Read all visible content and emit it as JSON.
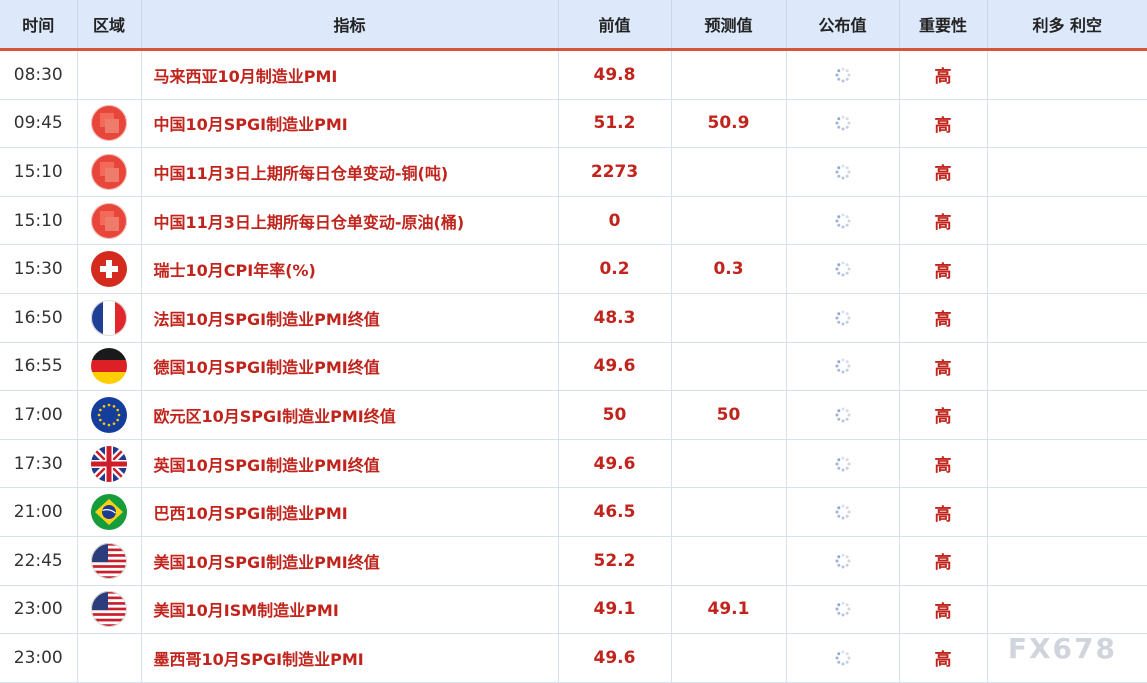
{
  "header": {
    "time": "时间",
    "region": "区域",
    "indicator": "指标",
    "previous": "前值",
    "forecast": "预测值",
    "actual": "公布值",
    "importance": "重要性",
    "effect": "利多 利空"
  },
  "colors": {
    "accent_red": "#c0241c",
    "header_bg": "#dde9fb",
    "header_border": "#d4553c"
  },
  "rows": [
    {
      "time": "08:30",
      "flag": "none",
      "indicator": "马来西亚10月制造业PMI",
      "previous": "49.8",
      "forecast": "",
      "actual": "",
      "importance": "高",
      "effect": ""
    },
    {
      "time": "09:45",
      "flag": "china-flag-blurred",
      "indicator": "中国10月SPGI制造业PMI",
      "previous": "51.2",
      "forecast": "50.9",
      "actual": "",
      "importance": "高",
      "effect": ""
    },
    {
      "time": "15:10",
      "flag": "china-flag-blurred",
      "indicator": "中国11月3日上期所每日仓单变动-铜(吨)",
      "previous": "2273",
      "forecast": "",
      "actual": "",
      "importance": "高",
      "effect": ""
    },
    {
      "time": "15:10",
      "flag": "china-flag-blurred",
      "indicator": "中国11月3日上期所每日仓单变动-原油(桶)",
      "previous": "0",
      "forecast": "",
      "actual": "",
      "importance": "高",
      "effect": ""
    },
    {
      "time": "15:30",
      "flag": "switzerland-flag",
      "indicator": "瑞士10月CPI年率(%)",
      "previous": "0.2",
      "forecast": "0.3",
      "actual": "",
      "importance": "高",
      "effect": ""
    },
    {
      "time": "16:50",
      "flag": "france-flag",
      "indicator": "法国10月SPGI制造业PMI终值",
      "previous": "48.3",
      "forecast": "",
      "actual": "",
      "importance": "高",
      "effect": ""
    },
    {
      "time": "16:55",
      "flag": "germany-flag",
      "indicator": "德国10月SPGI制造业PMI终值",
      "previous": "49.6",
      "forecast": "",
      "actual": "",
      "importance": "高",
      "effect": ""
    },
    {
      "time": "17:00",
      "flag": "eu-flag",
      "indicator": "欧元区10月SPGI制造业PMI终值",
      "previous": "50",
      "forecast": "50",
      "actual": "",
      "importance": "高",
      "effect": ""
    },
    {
      "time": "17:30",
      "flag": "uk-flag",
      "indicator": "英国10月SPGI制造业PMI终值",
      "previous": "49.6",
      "forecast": "",
      "actual": "",
      "importance": "高",
      "effect": ""
    },
    {
      "time": "21:00",
      "flag": "brazil-flag",
      "indicator": "巴西10月SPGI制造业PMI",
      "previous": "46.5",
      "forecast": "",
      "actual": "",
      "importance": "高",
      "effect": ""
    },
    {
      "time": "22:45",
      "flag": "usa-flag",
      "indicator": "美国10月SPGI制造业PMI终值",
      "previous": "52.2",
      "forecast": "",
      "actual": "",
      "importance": "高",
      "effect": ""
    },
    {
      "time": "23:00",
      "flag": "usa-flag",
      "indicator": "美国10月ISM制造业PMI",
      "previous": "49.1",
      "forecast": "49.1",
      "actual": "",
      "importance": "高",
      "effect": ""
    },
    {
      "time": "23:00",
      "flag": "none",
      "indicator": "墨西哥10月SPGI制造业PMI",
      "previous": "49.6",
      "forecast": "",
      "actual": "",
      "importance": "高",
      "effect": ""
    }
  ],
  "watermark": "FX678"
}
